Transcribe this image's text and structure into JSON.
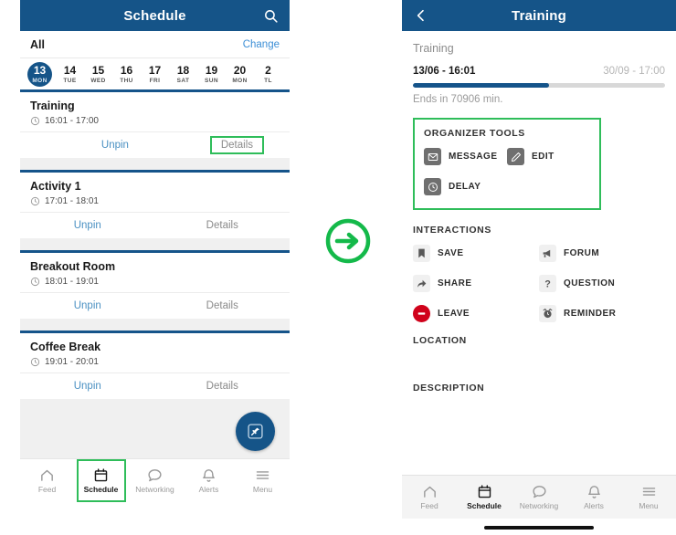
{
  "colors": {
    "brand_blue": "#155488",
    "accent_green": "#2fbd5a",
    "link_blue": "#4a90c2",
    "leave_red": "#d0021b",
    "muted_gray": "#8a8a8a"
  },
  "left_panel": {
    "appbar": {
      "title": "Schedule",
      "search_icon": "search-icon"
    },
    "filter": {
      "label": "All",
      "change_label": "Change"
    },
    "date_strip": [
      {
        "day": "13",
        "dow": "MON",
        "selected": true
      },
      {
        "day": "14",
        "dow": "TUE",
        "selected": false
      },
      {
        "day": "15",
        "dow": "WED",
        "selected": false
      },
      {
        "day": "16",
        "dow": "THU",
        "selected": false
      },
      {
        "day": "17",
        "dow": "FRI",
        "selected": false
      },
      {
        "day": "18",
        "dow": "SAT",
        "selected": false
      },
      {
        "day": "19",
        "dow": "SUN",
        "selected": false
      },
      {
        "day": "20",
        "dow": "MON",
        "selected": false
      },
      {
        "day": "2",
        "dow": "TL",
        "selected": false
      }
    ],
    "events": [
      {
        "title": "Training",
        "time": "16:01 - 17:00",
        "unpin": "Unpin",
        "details": "Details",
        "details_highlighted": true
      },
      {
        "title": "Activity 1",
        "time": "17:01 - 18:01",
        "unpin": "Unpin",
        "details": "Details",
        "details_highlighted": false
      },
      {
        "title": "Breakout Room",
        "time": "18:01 - 19:01",
        "unpin": "Unpin",
        "details": "Details",
        "details_highlighted": false
      },
      {
        "title": "Coffee Break",
        "time": "19:01 - 20:01",
        "unpin": "Unpin",
        "details": "Details",
        "details_highlighted": false
      }
    ],
    "fab": {
      "icon": "pin-icon"
    },
    "bottom_nav": [
      {
        "label": "Feed",
        "icon": "home-icon",
        "active": false,
        "highlighted": false
      },
      {
        "label": "Schedule",
        "icon": "calendar-icon",
        "active": true,
        "highlighted": true
      },
      {
        "label": "Networking",
        "icon": "chat-icon",
        "active": false,
        "highlighted": false
      },
      {
        "label": "Alerts",
        "icon": "bell-icon",
        "active": false,
        "highlighted": false
      },
      {
        "label": "Menu",
        "icon": "hamburger-icon",
        "active": false,
        "highlighted": false
      }
    ]
  },
  "transition": {
    "icon": "arrow-right-circle-icon"
  },
  "right_panel": {
    "appbar": {
      "title": "Training",
      "back_icon": "chevron-left-icon"
    },
    "subtitle": "Training",
    "progress": {
      "start": "13/06 - 16:01",
      "end": "30/09 - 17:00",
      "percent": 54,
      "note": "Ends in 70906 min."
    },
    "organizer_tools": {
      "heading": "ORGANIZER TOOLS",
      "highlighted": true,
      "items": [
        {
          "label": "MESSAGE",
          "icon": "envelope-icon",
          "style": "dark"
        },
        {
          "label": "EDIT",
          "icon": "pencil-icon",
          "style": "dark"
        },
        {
          "label": "DELAY",
          "icon": "clock-icon",
          "style": "dark"
        }
      ]
    },
    "interactions": {
      "heading": "INTERACTIONS",
      "items": [
        {
          "label": "SAVE",
          "icon": "bookmark-icon",
          "style": "light"
        },
        {
          "label": "FORUM",
          "icon": "megaphone-icon",
          "style": "light"
        },
        {
          "label": "SHARE",
          "icon": "share-icon",
          "style": "light"
        },
        {
          "label": "QUESTION",
          "icon": "question-icon",
          "style": "light"
        },
        {
          "label": "LEAVE",
          "icon": "minus-circle-icon",
          "style": "red"
        },
        {
          "label": "REMINDER",
          "icon": "alarm-icon",
          "style": "light"
        }
      ]
    },
    "location": {
      "heading": "LOCATION"
    },
    "description": {
      "heading": "DESCRIPTION"
    },
    "bottom_nav": [
      {
        "label": "Feed",
        "icon": "home-icon",
        "active": false
      },
      {
        "label": "Schedule",
        "icon": "calendar-icon",
        "active": true
      },
      {
        "label": "Networking",
        "icon": "chat-icon",
        "active": false
      },
      {
        "label": "Alerts",
        "icon": "bell-icon",
        "active": false
      },
      {
        "label": "Menu",
        "icon": "hamburger-icon",
        "active": false
      }
    ]
  }
}
